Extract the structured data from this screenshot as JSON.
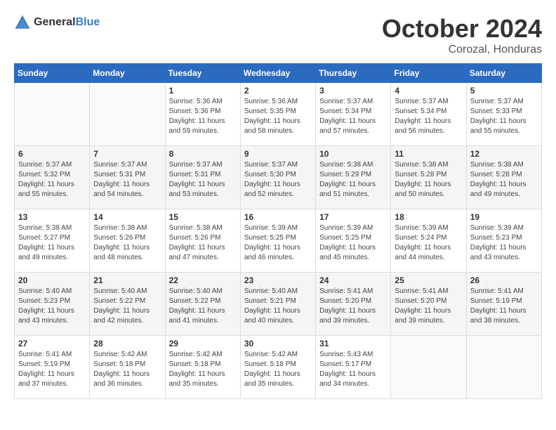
{
  "logo": {
    "text_general": "General",
    "text_blue": "Blue"
  },
  "header": {
    "month": "October 2024",
    "location": "Corozal, Honduras"
  },
  "weekdays": [
    "Sunday",
    "Monday",
    "Tuesday",
    "Wednesday",
    "Thursday",
    "Friday",
    "Saturday"
  ],
  "weeks": [
    [
      {
        "day": "",
        "sunrise": "",
        "sunset": "",
        "daylight": ""
      },
      {
        "day": "",
        "sunrise": "",
        "sunset": "",
        "daylight": ""
      },
      {
        "day": "1",
        "sunrise": "Sunrise: 5:36 AM",
        "sunset": "Sunset: 5:36 PM",
        "daylight": "Daylight: 11 hours and 59 minutes."
      },
      {
        "day": "2",
        "sunrise": "Sunrise: 5:36 AM",
        "sunset": "Sunset: 5:35 PM",
        "daylight": "Daylight: 11 hours and 58 minutes."
      },
      {
        "day": "3",
        "sunrise": "Sunrise: 5:37 AM",
        "sunset": "Sunset: 5:34 PM",
        "daylight": "Daylight: 11 hours and 57 minutes."
      },
      {
        "day": "4",
        "sunrise": "Sunrise: 5:37 AM",
        "sunset": "Sunset: 5:34 PM",
        "daylight": "Daylight: 11 hours and 56 minutes."
      },
      {
        "day": "5",
        "sunrise": "Sunrise: 5:37 AM",
        "sunset": "Sunset: 5:33 PM",
        "daylight": "Daylight: 11 hours and 55 minutes."
      }
    ],
    [
      {
        "day": "6",
        "sunrise": "Sunrise: 5:37 AM",
        "sunset": "Sunset: 5:32 PM",
        "daylight": "Daylight: 11 hours and 55 minutes."
      },
      {
        "day": "7",
        "sunrise": "Sunrise: 5:37 AM",
        "sunset": "Sunset: 5:31 PM",
        "daylight": "Daylight: 11 hours and 54 minutes."
      },
      {
        "day": "8",
        "sunrise": "Sunrise: 5:37 AM",
        "sunset": "Sunset: 5:31 PM",
        "daylight": "Daylight: 11 hours and 53 minutes."
      },
      {
        "day": "9",
        "sunrise": "Sunrise: 5:37 AM",
        "sunset": "Sunset: 5:30 PM",
        "daylight": "Daylight: 11 hours and 52 minutes."
      },
      {
        "day": "10",
        "sunrise": "Sunrise: 5:38 AM",
        "sunset": "Sunset: 5:29 PM",
        "daylight": "Daylight: 11 hours and 51 minutes."
      },
      {
        "day": "11",
        "sunrise": "Sunrise: 5:38 AM",
        "sunset": "Sunset: 5:28 PM",
        "daylight": "Daylight: 11 hours and 50 minutes."
      },
      {
        "day": "12",
        "sunrise": "Sunrise: 5:38 AM",
        "sunset": "Sunset: 5:28 PM",
        "daylight": "Daylight: 11 hours and 49 minutes."
      }
    ],
    [
      {
        "day": "13",
        "sunrise": "Sunrise: 5:38 AM",
        "sunset": "Sunset: 5:27 PM",
        "daylight": "Daylight: 11 hours and 49 minutes."
      },
      {
        "day": "14",
        "sunrise": "Sunrise: 5:38 AM",
        "sunset": "Sunset: 5:26 PM",
        "daylight": "Daylight: 11 hours and 48 minutes."
      },
      {
        "day": "15",
        "sunrise": "Sunrise: 5:38 AM",
        "sunset": "Sunset: 5:26 PM",
        "daylight": "Daylight: 11 hours and 47 minutes."
      },
      {
        "day": "16",
        "sunrise": "Sunrise: 5:39 AM",
        "sunset": "Sunset: 5:25 PM",
        "daylight": "Daylight: 11 hours and 46 minutes."
      },
      {
        "day": "17",
        "sunrise": "Sunrise: 5:39 AM",
        "sunset": "Sunset: 5:25 PM",
        "daylight": "Daylight: 11 hours and 45 minutes."
      },
      {
        "day": "18",
        "sunrise": "Sunrise: 5:39 AM",
        "sunset": "Sunset: 5:24 PM",
        "daylight": "Daylight: 11 hours and 44 minutes."
      },
      {
        "day": "19",
        "sunrise": "Sunrise: 5:39 AM",
        "sunset": "Sunset: 5:23 PM",
        "daylight": "Daylight: 11 hours and 43 minutes."
      }
    ],
    [
      {
        "day": "20",
        "sunrise": "Sunrise: 5:40 AM",
        "sunset": "Sunset: 5:23 PM",
        "daylight": "Daylight: 11 hours and 43 minutes."
      },
      {
        "day": "21",
        "sunrise": "Sunrise: 5:40 AM",
        "sunset": "Sunset: 5:22 PM",
        "daylight": "Daylight: 11 hours and 42 minutes."
      },
      {
        "day": "22",
        "sunrise": "Sunrise: 5:40 AM",
        "sunset": "Sunset: 5:22 PM",
        "daylight": "Daylight: 11 hours and 41 minutes."
      },
      {
        "day": "23",
        "sunrise": "Sunrise: 5:40 AM",
        "sunset": "Sunset: 5:21 PM",
        "daylight": "Daylight: 11 hours and 40 minutes."
      },
      {
        "day": "24",
        "sunrise": "Sunrise: 5:41 AM",
        "sunset": "Sunset: 5:20 PM",
        "daylight": "Daylight: 11 hours and 39 minutes."
      },
      {
        "day": "25",
        "sunrise": "Sunrise: 5:41 AM",
        "sunset": "Sunset: 5:20 PM",
        "daylight": "Daylight: 11 hours and 39 minutes."
      },
      {
        "day": "26",
        "sunrise": "Sunrise: 5:41 AM",
        "sunset": "Sunset: 5:19 PM",
        "daylight": "Daylight: 11 hours and 38 minutes."
      }
    ],
    [
      {
        "day": "27",
        "sunrise": "Sunrise: 5:41 AM",
        "sunset": "Sunset: 5:19 PM",
        "daylight": "Daylight: 11 hours and 37 minutes."
      },
      {
        "day": "28",
        "sunrise": "Sunrise: 5:42 AM",
        "sunset": "Sunset: 5:18 PM",
        "daylight": "Daylight: 11 hours and 36 minutes."
      },
      {
        "day": "29",
        "sunrise": "Sunrise: 5:42 AM",
        "sunset": "Sunset: 5:18 PM",
        "daylight": "Daylight: 11 hours and 35 minutes."
      },
      {
        "day": "30",
        "sunrise": "Sunrise: 5:42 AM",
        "sunset": "Sunset: 5:18 PM",
        "daylight": "Daylight: 11 hours and 35 minutes."
      },
      {
        "day": "31",
        "sunrise": "Sunrise: 5:43 AM",
        "sunset": "Sunset: 5:17 PM",
        "daylight": "Daylight: 11 hours and 34 minutes."
      },
      {
        "day": "",
        "sunrise": "",
        "sunset": "",
        "daylight": ""
      },
      {
        "day": "",
        "sunrise": "",
        "sunset": "",
        "daylight": ""
      }
    ]
  ]
}
